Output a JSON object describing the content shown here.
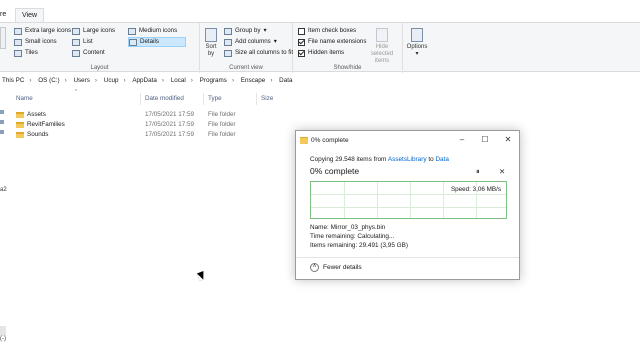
{
  "tabs": [
    {
      "label": "re"
    },
    {
      "label": "View"
    }
  ],
  "ribbon": {
    "layout": {
      "items": [
        "Extra large icons",
        "Large icons",
        "Medium icons",
        "Small icons",
        "List",
        "Details",
        "Tiles",
        "Content"
      ],
      "label": "Layout"
    },
    "current_view": {
      "sort_label": "Sort\nby",
      "group_by": "Group by",
      "add_columns": "Add columns",
      "size_all_columns": "Size all columns to fit",
      "label": "Current view"
    },
    "show_hide": {
      "item_check_boxes": "Item check boxes",
      "file_name_extensions": "File name extensions",
      "hidden_items": "Hidden items",
      "hide_selected": "Hide selected items",
      "label": "Show/hide"
    },
    "options": "Options"
  },
  "address": [
    "This PC",
    "OS (C:)",
    "Users",
    "Ucup",
    "AppData",
    "Local",
    "Programs",
    "Enscape",
    "Data"
  ],
  "columns": [
    "Name",
    "Date modified",
    "Type",
    "Size"
  ],
  "files": [
    {
      "name": "Assets",
      "date": "17/05/2021 17:59",
      "type": "File folder"
    },
    {
      "name": "RevitFamilies",
      "date": "17/05/2021 17:59",
      "type": "File folder"
    },
    {
      "name": "Sounds",
      "date": "17/05/2021 17:59",
      "type": "File folder"
    }
  ],
  "dialog": {
    "title": "0% complete",
    "copy_prefix": "Copying 29.548 items from",
    "source": "AssetsLibrary",
    "to": "to",
    "dest": "Data",
    "percent_heading": "0% complete",
    "speed": "Speed: 3,06 MB/s",
    "progress": 0.0,
    "name_line": "Name: Mirror_03_phys.bin",
    "time_line": "Time remaining: Calculating...",
    "items_line": "Items remaining: 29.491 (3,95 GB)",
    "fewer_details": "Fewer details"
  },
  "left_edge": [
    "re",
    "a2",
    "(-)"
  ]
}
